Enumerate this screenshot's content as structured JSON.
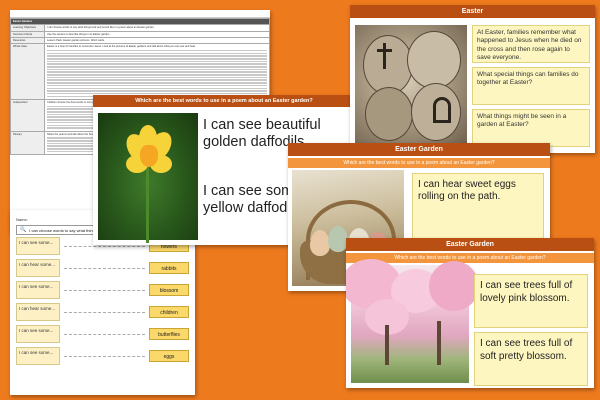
{
  "lesson_plan": {
    "header_left": "Easter Gardens",
    "rows": [
      {
        "label": "Learning Objectives",
        "text": "I can choose words to say what things look and sound like in a poem about an Easter garden."
      },
      {
        "label": "Success Criteria",
        "text": "Use the senses to describe things in an Easter garden."
      },
      {
        "label": "Resources",
        "text": "Lesson Pack. Easter garden pictures. Word cards."
      },
      {
        "label": "Whole class",
        "text": "Easter is a time for families to remember Jesus. Look at the pictures of Easter gardens and talk about what you can see and hear."
      },
      {
        "label": "Independent",
        "text": "Children choose the best words to complete the sentences on the activity sheet."
      },
      {
        "label": "Plenary",
        "text": "Share the poems and talk about the best words used."
      }
    ]
  },
  "worksheet": {
    "name_label": "Name:",
    "date_label": "Date:",
    "objective": "I can choose words to say what things look and sound like.",
    "rows": [
      {
        "prompt": "I can see some...",
        "word": "flowers"
      },
      {
        "prompt": "I can hear some...",
        "word": "rabbits"
      },
      {
        "prompt": "I can see some...",
        "word": "blossom"
      },
      {
        "prompt": "I can hear some...",
        "word": "children"
      },
      {
        "prompt": "I can see some...",
        "word": "butterflies"
      },
      {
        "prompt": "I can see some...",
        "word": "eggs"
      }
    ]
  },
  "slide_daffodil": {
    "question": "Which are the best words to use in a poem about an Easter garden?",
    "line1": "I can see beautiful",
    "line2": "golden daffodils",
    "line3": "I can see some",
    "line4": "yellow daffodils"
  },
  "slide_easter": {
    "title": "Easter",
    "q1": "At Easter, families remember what happened to Jesus when he died on the cross and then rose again to save everyone.",
    "q2": "What special things can families do together at Easter?",
    "q3": "What things might be seen in a garden at Easter?"
  },
  "slide_eggs": {
    "title": "Easter Garden",
    "question": "Which are the best words to use in a poem about an Easter garden?",
    "answer": "I can hear sweet eggs rolling on the path."
  },
  "slide_blossom": {
    "title": "Easter Garden",
    "question": "Which are the best words to use in a poem about an Easter garden?",
    "answer1": "I can see trees full of lovely pink blossom.",
    "answer2": "I can see trees full of soft pretty blossom."
  },
  "colors": {
    "background": "#ee7a1e",
    "title_band": "#b94f12",
    "question_band": "#f2953c",
    "answer_box": "#fef6c0"
  }
}
